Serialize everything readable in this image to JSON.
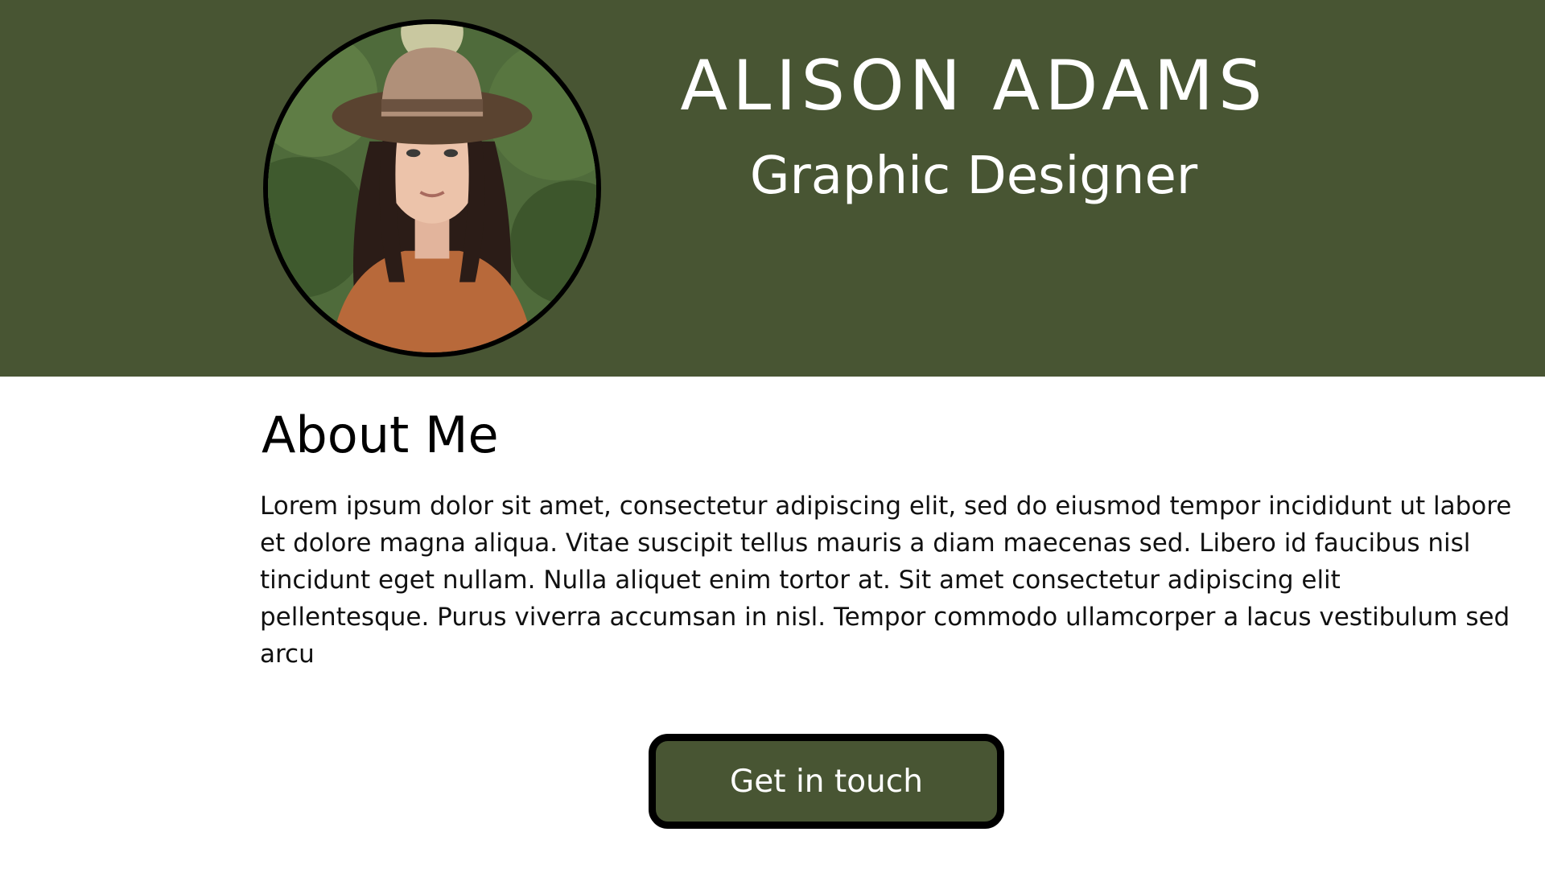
{
  "header": {
    "name": "ALISON ADAMS",
    "role": "Graphic Designer",
    "background_color": "#485533"
  },
  "profile_photo": {
    "description": "portrait-photo"
  },
  "about": {
    "title": "About Me",
    "text": "Lorem ipsum dolor sit amet, consectetur adipiscing elit, sed do eiusmod tempor incididunt ut labore et dolore magna aliqua. Vitae suscipit tellus mauris a diam maecenas sed. Libero id faucibus nisl tincidunt eget nullam. Nulla aliquet enim tortor at. Sit amet consectetur adipiscing elit pellentesque. Purus viverra accumsan in nisl. Tempor commodo ullamcorper a lacus vestibulum sed arcu"
  },
  "cta": {
    "label": "Get in touch",
    "background_color": "#485533",
    "border_color": "#000000"
  }
}
